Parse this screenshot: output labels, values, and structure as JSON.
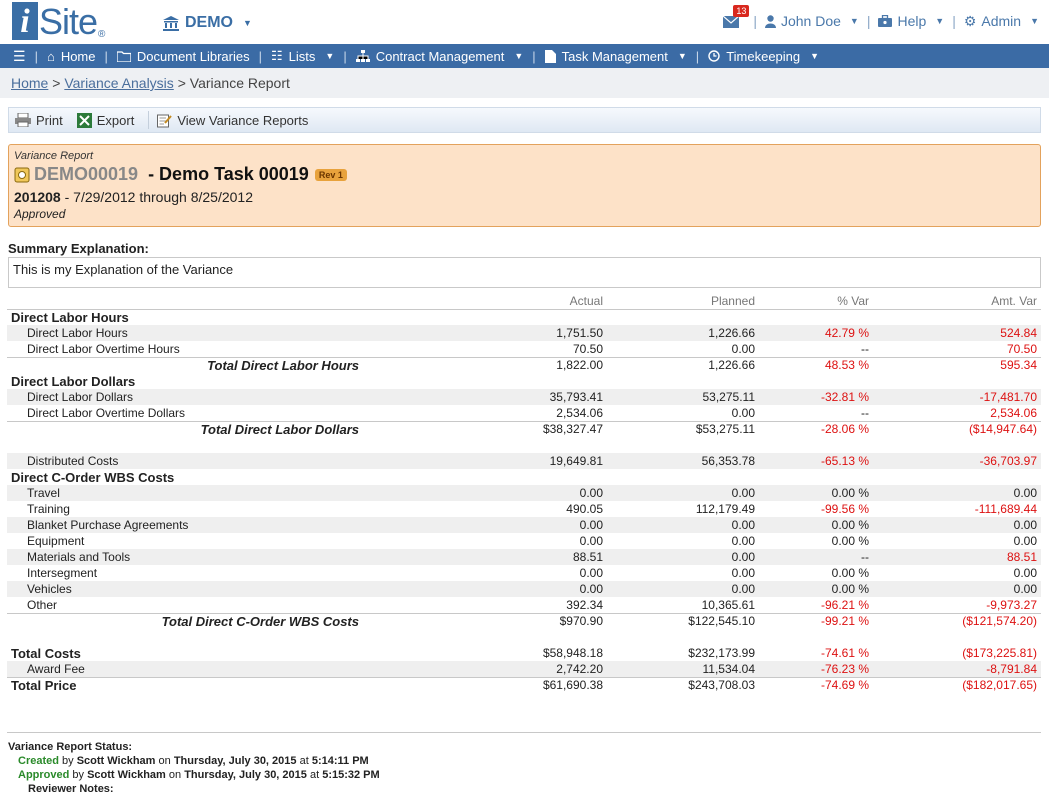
{
  "app": {
    "logo_i": "i",
    "logo_rest": "Site",
    "logo_mark": "®",
    "site": "DEMO",
    "mail_count": "13",
    "user": "John Doe",
    "help": "Help",
    "admin": "Admin"
  },
  "nav": {
    "home": "Home",
    "doc_libs": "Document Libraries",
    "lists": "Lists",
    "contract": "Contract Management",
    "task": "Task Management",
    "time": "Timekeeping"
  },
  "breadcrumb": {
    "home": "Home",
    "sep1": ">",
    "variance": "Variance Analysis",
    "sep2": ">",
    "current": "Variance Report"
  },
  "toolbar": {
    "print": "Print",
    "export": "Export",
    "view": "View Variance Reports"
  },
  "report": {
    "label": "Variance Report",
    "id": "DEMO00019",
    "task": "- Demo Task 00019",
    "rev": "Rev 1",
    "period_code": "201208",
    "period_range": "- 7/29/2012 through 8/25/2012",
    "status": "Approved"
  },
  "summary": {
    "label": "Summary Explanation:",
    "text": "This is my Explanation of the Variance"
  },
  "columns": {
    "actual": "Actual",
    "planned": "Planned",
    "pct": "% Var",
    "amt": "Amt. Var"
  },
  "sections": {
    "dlh": {
      "title": "Direct Labor Hours",
      "r1": {
        "label": "Direct Labor Hours",
        "actual": "1,751.50",
        "planned": "1,226.66",
        "pct": "42.79 %",
        "amt": "524.84"
      },
      "r2": {
        "label": "Direct Labor Overtime Hours",
        "actual": "70.50",
        "planned": "0.00",
        "pct": "--",
        "amt": "70.50"
      },
      "total": {
        "label": "Total Direct Labor Hours",
        "actual": "1,822.00",
        "planned": "1,226.66",
        "pct": "48.53 %",
        "amt": "595.34"
      }
    },
    "dld": {
      "title": "Direct Labor Dollars",
      "r1": {
        "label": "Direct Labor Dollars",
        "actual": "35,793.41",
        "planned": "53,275.11",
        "pct": "-32.81 %",
        "amt": "-17,481.70"
      },
      "r2": {
        "label": "Direct Labor Overtime Dollars",
        "actual": "2,534.06",
        "planned": "0.00",
        "pct": "--",
        "amt": "2,534.06"
      },
      "total": {
        "label": "Total Direct Labor Dollars",
        "actual": "$38,327.47",
        "planned": "$53,275.11",
        "pct": "-28.06 %",
        "amt": "($14,947.64)"
      }
    },
    "dist": {
      "label": "Distributed Costs",
      "actual": "19,649.81",
      "planned": "56,353.78",
      "pct": "-65.13 %",
      "amt": "-36,703.97"
    },
    "wbs": {
      "title": "Direct C-Order WBS Costs",
      "travel": {
        "label": "Travel",
        "actual": "0.00",
        "planned": "0.00",
        "pct": "0.00 %",
        "amt": "0.00"
      },
      "training": {
        "label": "Training",
        "actual": "490.05",
        "planned": "112,179.49",
        "pct": "-99.56 %",
        "amt": "-111,689.44"
      },
      "bpa": {
        "label": "Blanket Purchase Agreements",
        "actual": "0.00",
        "planned": "0.00",
        "pct": "0.00 %",
        "amt": "0.00"
      },
      "equip": {
        "label": "Equipment",
        "actual": "0.00",
        "planned": "0.00",
        "pct": "0.00 %",
        "amt": "0.00"
      },
      "mat": {
        "label": "Materials and Tools",
        "actual": "88.51",
        "planned": "0.00",
        "pct": "--",
        "amt": "88.51"
      },
      "inter": {
        "label": "Intersegment",
        "actual": "0.00",
        "planned": "0.00",
        "pct": "0.00 %",
        "amt": "0.00"
      },
      "veh": {
        "label": "Vehicles",
        "actual": "0.00",
        "planned": "0.00",
        "pct": "0.00 %",
        "amt": "0.00"
      },
      "other": {
        "label": "Other",
        "actual": "392.34",
        "planned": "10,365.61",
        "pct": "-96.21 %",
        "amt": "-9,973.27"
      },
      "total": {
        "label": "Total Direct C-Order WBS Costs",
        "actual": "$970.90",
        "planned": "$122,545.10",
        "pct": "-99.21 %",
        "amt": "($121,574.20)"
      }
    },
    "costs": {
      "label": "Total Costs",
      "actual": "$58,948.18",
      "planned": "$232,173.99",
      "pct": "-74.61 %",
      "amt": "($173,225.81)"
    },
    "fee": {
      "label": "Award Fee",
      "actual": "2,742.20",
      "planned": "11,534.04",
      "pct": "-76.23 %",
      "amt": "-8,791.84"
    },
    "price": {
      "label": "Total Price",
      "actual": "$61,690.38",
      "planned": "$243,708.03",
      "pct": "-74.69 %",
      "amt": "($182,017.65)"
    }
  },
  "status": {
    "title": "Variance Report Status:",
    "created_word": "Created",
    "created_rest": " by ",
    "created_by": "Scott Wickham",
    "created_on": " on ",
    "created_date": "Thursday, July 30, 2015",
    "created_at": " at ",
    "created_time": "5:14:11 PM",
    "approved_word": "Approved",
    "approved_rest": " by ",
    "approved_by": "Scott Wickham",
    "approved_on": " on ",
    "approved_date": "Thursday, July 30, 2015",
    "approved_at": " at ",
    "approved_time": "5:15:32 PM",
    "notes": "Reviewer Notes:"
  }
}
